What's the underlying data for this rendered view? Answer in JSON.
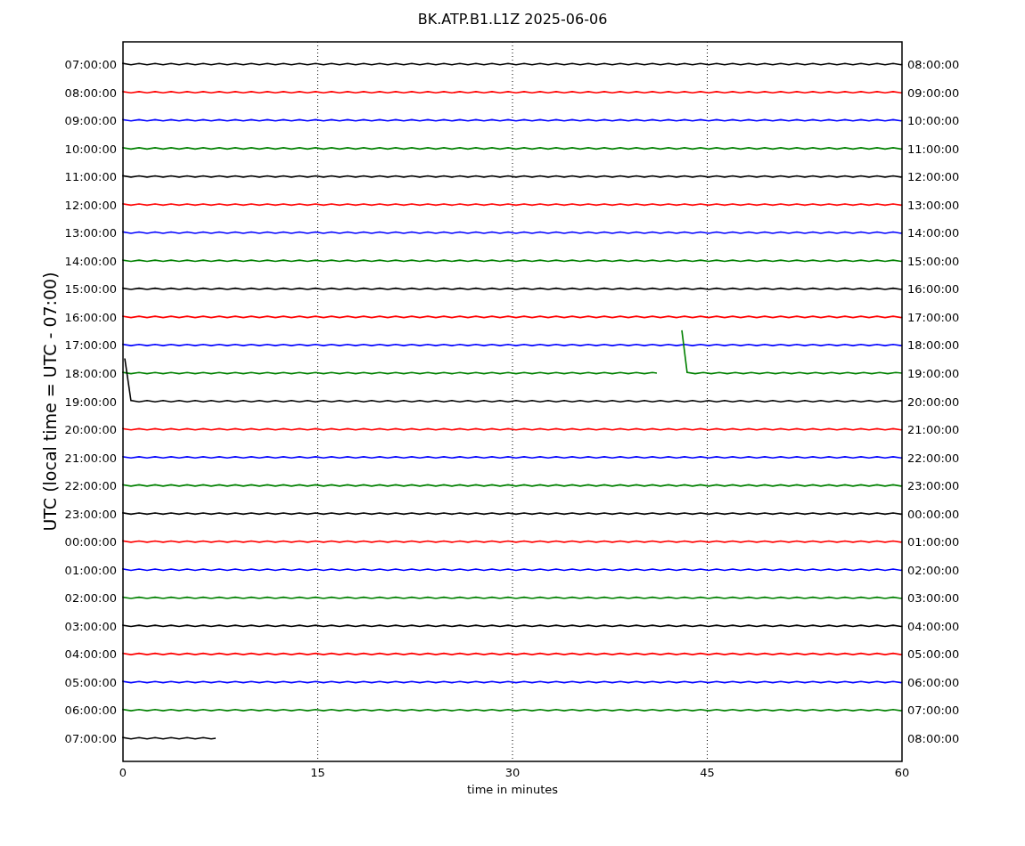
{
  "title": "BK.ATP.B1.L1Z 2025-06-06",
  "ylabel": "UTC (local time = UTC - 07:00)",
  "xlabel": "time in minutes",
  "xticks": [
    "0",
    "15",
    "30",
    "45",
    "60"
  ],
  "rows": [
    {
      "left": "07:00:00",
      "right": "08:00:00",
      "color": "#000000",
      "kind": "full"
    },
    {
      "left": "08:00:00",
      "right": "09:00:00",
      "color": "#ff0000",
      "kind": "full"
    },
    {
      "left": "09:00:00",
      "right": "10:00:00",
      "color": "#0000ff",
      "kind": "full"
    },
    {
      "left": "10:00:00",
      "right": "11:00:00",
      "color": "#008000",
      "kind": "full"
    },
    {
      "left": "11:00:00",
      "right": "12:00:00",
      "color": "#000000",
      "kind": "full"
    },
    {
      "left": "12:00:00",
      "right": "13:00:00",
      "color": "#ff0000",
      "kind": "full"
    },
    {
      "left": "13:00:00",
      "right": "14:00:00",
      "color": "#0000ff",
      "kind": "full"
    },
    {
      "left": "14:00:00",
      "right": "15:00:00",
      "color": "#008000",
      "kind": "full"
    },
    {
      "left": "15:00:00",
      "right": "16:00:00",
      "color": "#000000",
      "kind": "full"
    },
    {
      "left": "16:00:00",
      "right": "17:00:00",
      "color": "#ff0000",
      "kind": "full"
    },
    {
      "left": "17:00:00",
      "right": "18:00:00",
      "color": "#0000ff",
      "kind": "full"
    },
    {
      "left": "18:00:00",
      "right": "19:00:00",
      "color": "#008000",
      "kind": "gap"
    },
    {
      "left": "19:00:00",
      "right": "20:00:00",
      "color": "#000000",
      "kind": "step"
    },
    {
      "left": "20:00:00",
      "right": "21:00:00",
      "color": "#ff0000",
      "kind": "full"
    },
    {
      "left": "21:00:00",
      "right": "22:00:00",
      "color": "#0000ff",
      "kind": "full"
    },
    {
      "left": "22:00:00",
      "right": "23:00:00",
      "color": "#008000",
      "kind": "full"
    },
    {
      "left": "23:00:00",
      "right": "00:00:00",
      "color": "#000000",
      "kind": "full"
    },
    {
      "left": "00:00:00",
      "right": "01:00:00",
      "color": "#ff0000",
      "kind": "full"
    },
    {
      "left": "01:00:00",
      "right": "02:00:00",
      "color": "#0000ff",
      "kind": "full"
    },
    {
      "left": "02:00:00",
      "right": "03:00:00",
      "color": "#008000",
      "kind": "full"
    },
    {
      "left": "03:00:00",
      "right": "04:00:00",
      "color": "#000000",
      "kind": "full"
    },
    {
      "left": "04:00:00",
      "right": "05:00:00",
      "color": "#ff0000",
      "kind": "full"
    },
    {
      "left": "05:00:00",
      "right": "06:00:00",
      "color": "#0000ff",
      "kind": "full"
    },
    {
      "left": "06:00:00",
      "right": "07:00:00",
      "color": "#008000",
      "kind": "full"
    },
    {
      "left": "07:00:00",
      "right": "08:00:00",
      "color": "#000000",
      "kind": "partial"
    }
  ]
}
